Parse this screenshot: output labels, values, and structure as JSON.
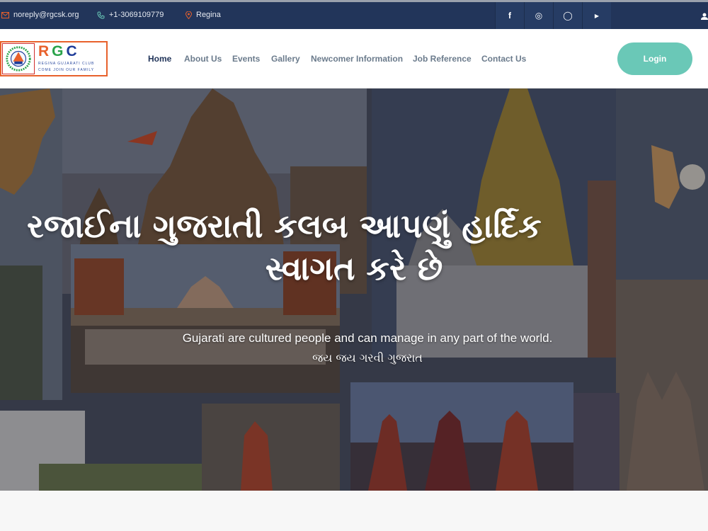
{
  "topbar": {
    "email": "noreply@rgcsk.org",
    "phone": "+1-3069109779",
    "location": "Regina",
    "social": [
      {
        "icon": "facebook-icon",
        "glyph": "f"
      },
      {
        "icon": "instagram-icon",
        "glyph": "◎"
      },
      {
        "icon": "whatsapp-icon",
        "glyph": "◯"
      },
      {
        "icon": "youtube-icon",
        "glyph": "▶"
      }
    ]
  },
  "logo": {
    "mark": "RGC",
    "tagline": "REGINA GUJARATI CLUB",
    "motto": "COME JOIN OUR FAMILY",
    "colors": {
      "r": "#e8612c",
      "g": "#2aa34a",
      "c": "#1f3d99"
    }
  },
  "nav": {
    "items": [
      "Home",
      "About Us",
      "Events",
      "Gallery",
      "Newcomer Information",
      "Job Reference",
      "Contact Us"
    ],
    "active": "Home",
    "login_label": "Login"
  },
  "hero": {
    "title_line1": "રજાઈના ગુજરાતી કલબ આપણું હાર્દિક",
    "title_line2": "સ્વાગત કરે છે",
    "subtitle": "Gujarati are cultured people and can manage in any part of the world.",
    "tagline": "જય જય ગરવી ગુજરાત"
  },
  "colors": {
    "topbar": "#22355a",
    "accent": "#6ac8b7",
    "nav_active": "#22355a",
    "nav_text": "#6b7b8c"
  }
}
